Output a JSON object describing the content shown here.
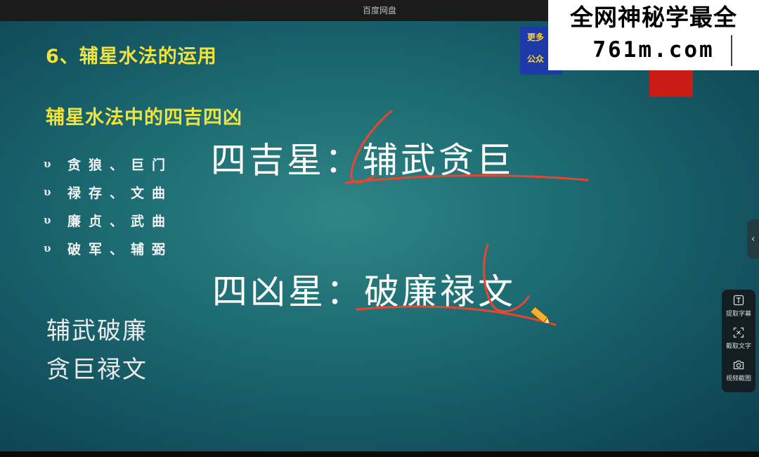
{
  "window": {
    "title": "百度网盘"
  },
  "slide": {
    "heading": "6、辅星水法的运用",
    "subheading": "辅星水法中的四吉四凶",
    "bullet_symbol": "υ",
    "bullets": [
      "贪狼、巨门",
      "禄存、文曲",
      "廉贞、武曲",
      "破军、辅弼"
    ],
    "lucky_line": "四吉星：辅武贪巨",
    "unlucky_line": "四凶星：破廉禄文",
    "summary": [
      "辅武破廉",
      "贪巨禄文"
    ]
  },
  "overlay": {
    "wechat_text": [
      "更多",
      "公众"
    ],
    "watermark_line1": "全网神秘学最全",
    "watermark_line2": "761m.com"
  },
  "toolbar": {
    "collapse_icon": "chevron-left-icon",
    "tools": [
      {
        "icon": "extract-subtitle-icon",
        "label": "提取字幕"
      },
      {
        "icon": "capture-text-icon",
        "label": "截取文字"
      },
      {
        "icon": "camera-icon",
        "label": "视频截图"
      }
    ]
  },
  "colors": {
    "heading": "#f2e33a",
    "annotation": "#e8462f",
    "background": "#1c6a72"
  }
}
